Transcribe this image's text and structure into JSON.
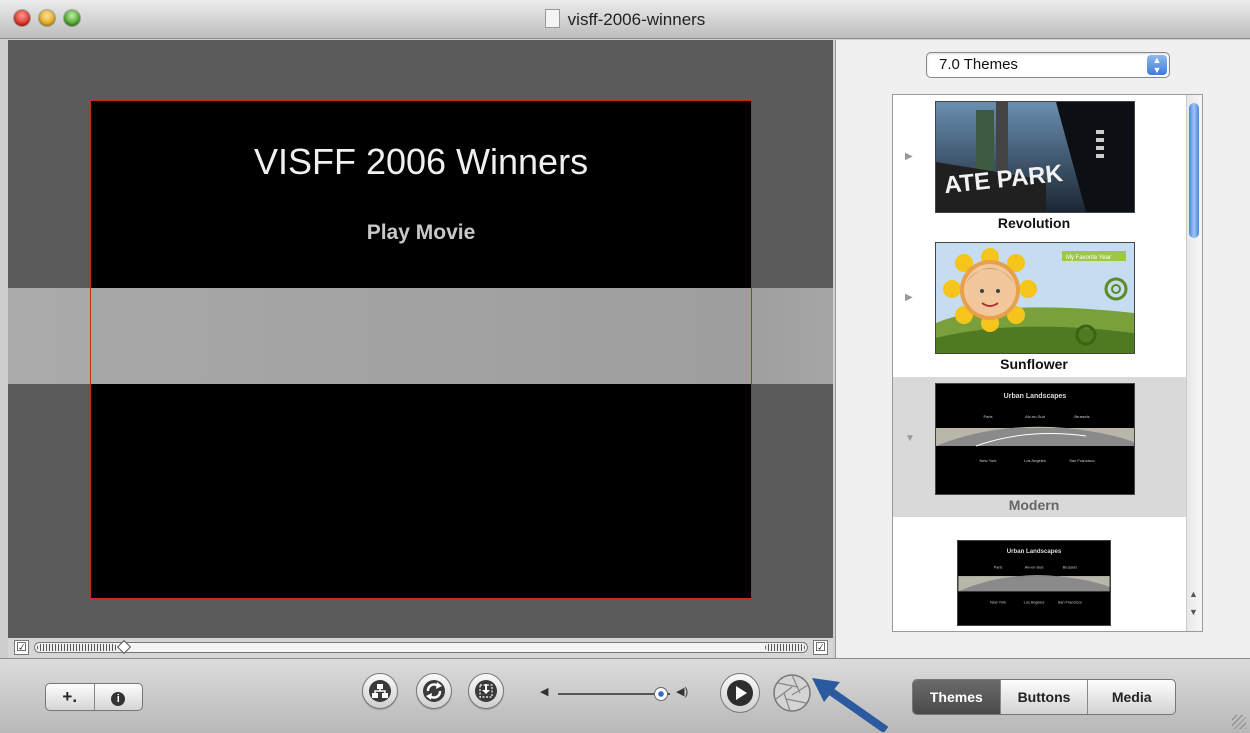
{
  "window": {
    "title": "visff-2006-winners"
  },
  "preview": {
    "menu_title": "VISFF 2006 Winners",
    "menu_item": "Play Movie"
  },
  "scrubber": {
    "left_check": "☑",
    "right_check": "☑"
  },
  "themes_panel": {
    "set_selector": "7.0 Themes",
    "themes": [
      {
        "name": "Revolution",
        "selected": false
      },
      {
        "name": "Sunflower",
        "selected": false
      },
      {
        "name": "Modern",
        "selected": true
      },
      {
        "name": "",
        "selected": false
      }
    ],
    "thumb_texts": {
      "revolution_sign": "ATE PARK",
      "modern_heading": "Urban Landscapes",
      "modern_row1": [
        "Paris",
        "Aix-en-Sud",
        "Brussels"
      ],
      "modern_row2": [
        "New York",
        "Los Angeles",
        "San Francisco"
      ],
      "sunflower_heading": "My Favorite Year"
    }
  },
  "toolbar": {
    "add_label": "+.",
    "info_label": "i",
    "segments": [
      "Themes",
      "Buttons",
      "Media"
    ],
    "active_segment": "Themes"
  },
  "colors": {
    "accent": "#3c7ddc",
    "frame_red": "#c62a1f",
    "arrow": "#2c5aa0"
  }
}
